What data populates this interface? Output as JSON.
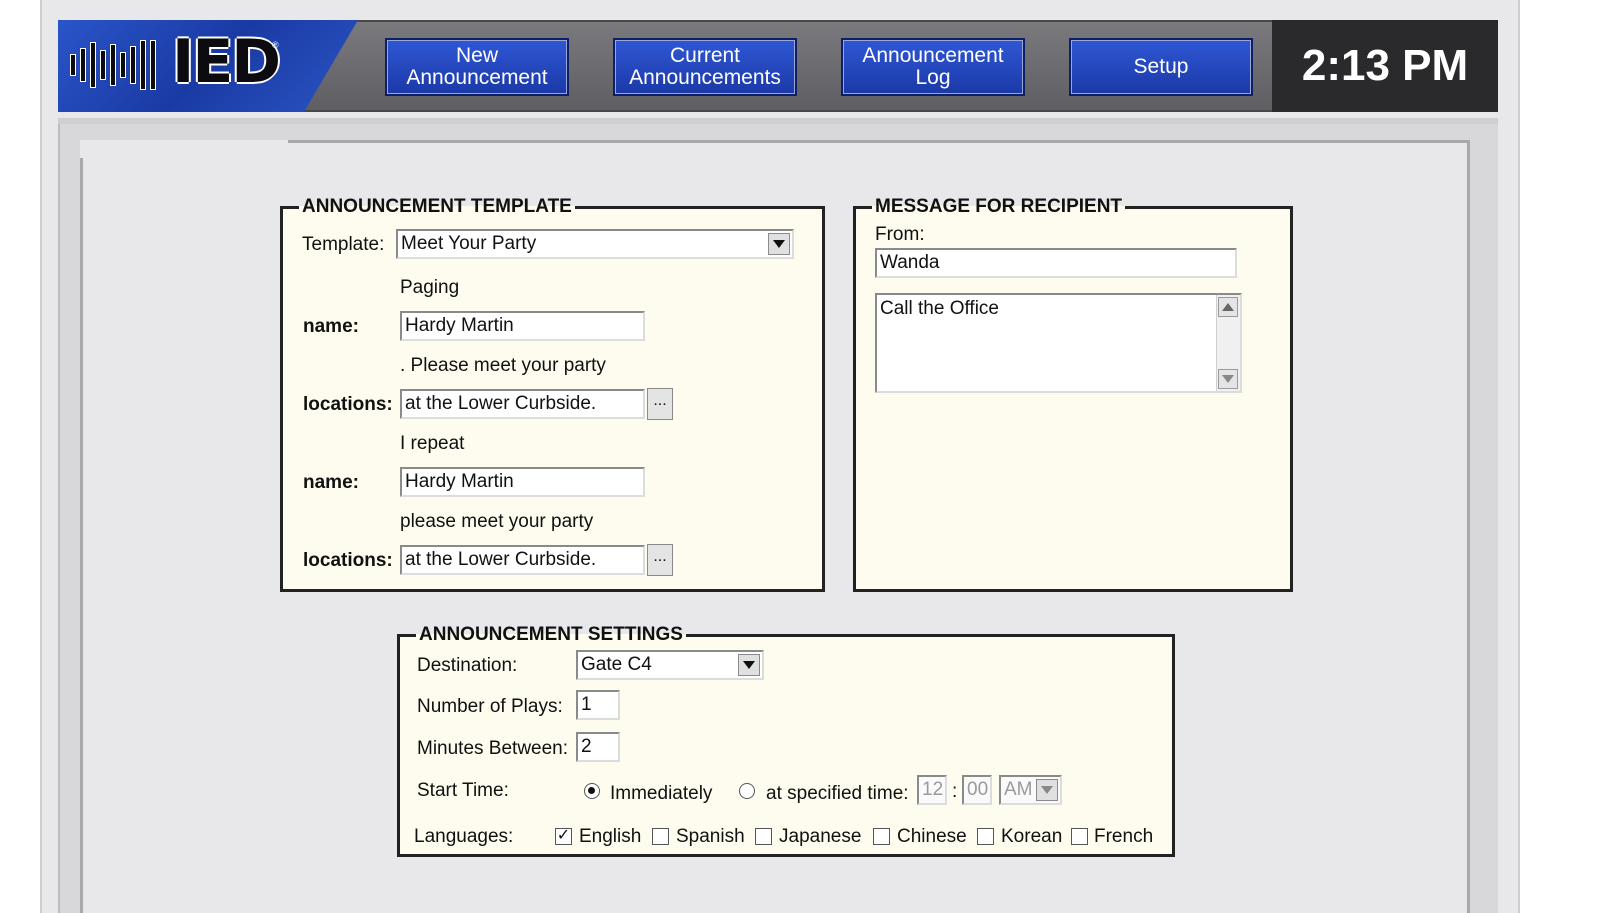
{
  "logo": {
    "text": "IED",
    "reg": "®"
  },
  "nav": [
    {
      "label": "New Announcement"
    },
    {
      "label": "Current Announcements"
    },
    {
      "label": "Announcement Log"
    },
    {
      "label": "Setup"
    }
  ],
  "clock": "2:13 PM",
  "template_panel": {
    "legend": "ANNOUNCEMENT TEMPLATE",
    "template_label": "Template:",
    "template_value": "Meet Your Party",
    "text1": "Paging",
    "name_label": "name:",
    "name1_value": "Hardy Martin",
    "text2": ". Please meet your party",
    "locations_label": "locations:",
    "location1_value": "at the Lower Curbside.",
    "ellipsis": "...",
    "text3": "I repeat",
    "name2_value": "Hardy Martin",
    "text4": "please meet your party",
    "location2_value": "at the Lower Curbside."
  },
  "message_panel": {
    "legend": "MESSAGE FOR RECIPIENT",
    "from_label": "From:",
    "from_value": "Wanda",
    "message_value": "Call the Office"
  },
  "settings_panel": {
    "legend": "ANNOUNCEMENT SETTINGS",
    "destination_label": "Destination:",
    "destination_value": "Gate C4",
    "plays_label": "Number of Plays:",
    "plays_value": "1",
    "minutes_label": "Minutes Between:",
    "minutes_value": "2",
    "start_label": "Start Time:",
    "immediately_label": "Immediately",
    "specified_label": "at specified time:",
    "hour_value": "12",
    "time_sep": ":",
    "minute_value": "00",
    "ampm_value": "AM",
    "languages_label": "Languages:",
    "languages": [
      {
        "label": "English",
        "checked": true
      },
      {
        "label": "Spanish",
        "checked": false
      },
      {
        "label": "Japanese",
        "checked": false
      },
      {
        "label": "Chinese",
        "checked": false
      },
      {
        "label": "Korean",
        "checked": false
      },
      {
        "label": "French",
        "checked": false
      }
    ]
  },
  "colors": {
    "nav_blue": "#1b39a8",
    "panel_bg": "#fdfcee",
    "topbar_grey": "#6a6a6e"
  }
}
